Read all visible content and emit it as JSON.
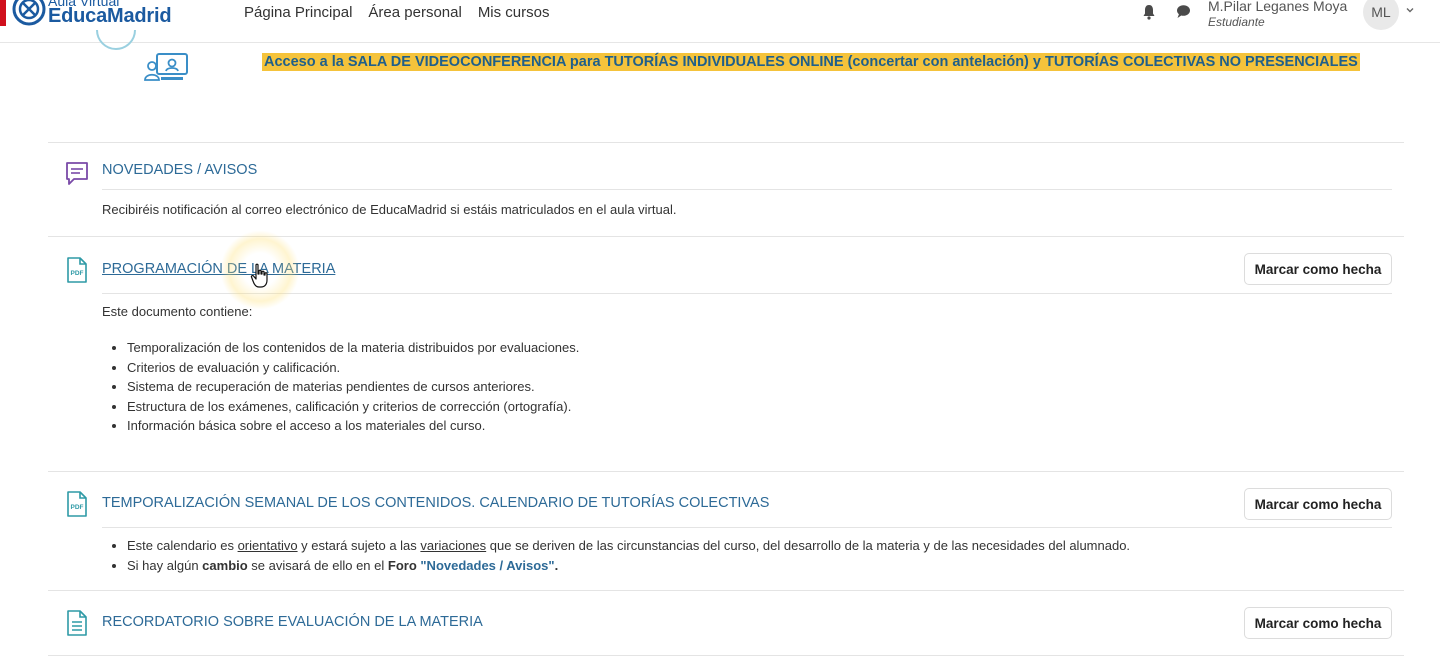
{
  "navbar": {
    "brand_small": "Aula Virtual",
    "brand_big": "EducaMadrid",
    "links": [
      "Página Principal",
      "Área personal",
      "Mis cursos"
    ],
    "user_name": "M.Pilar Leganes Moya",
    "user_role": "Estudiante",
    "avatar_initials": "ML"
  },
  "banner": {
    "text": "Acceso a la SALA DE VIDEOCONFERENCIA para TUTORÍAS INDIVIDUALES ONLINE (concertar con antelación) y TUTORÍAS COLECTIVAS NO PRESENCIALES",
    "highlight_color": "#f5c33b"
  },
  "activities": [
    {
      "title": "NOVEDADES / AVISOS",
      "icon": "forum-icon",
      "description": "Recibiréis notificación al correo electrónico de EducaMadrid si estáis matriculados en el aula virtual."
    },
    {
      "title": "PROGRAMACIÓN DE LA MATERIA",
      "icon": "pdf-icon",
      "button": "Marcar como hecha",
      "intro": "Este documento contiene:",
      "bullets": [
        "Temporalización de los contenidos de la materia distribuidos por evaluaciones.",
        "Criterios de evaluación y calificación.",
        "Sistema de recuperación de materias pendientes de cursos anteriores.",
        "Estructura de los exámenes, calificación y criterios de corrección (ortografía).",
        "Información básica sobre el acceso a los materiales del curso."
      ]
    },
    {
      "title": "TEMPORALIZACIÓN SEMANAL DE LOS CONTENIDOS. CALENDARIO DE TUTORÍAS COLECTIVAS",
      "icon": "pdf-icon",
      "button": "Marcar como hecha",
      "bullet1": {
        "p1": "Este calendario es ",
        "u1": "orientativo",
        "p2": " y estará sujeto a las ",
        "u2": "variaciones",
        "p3": " que se deriven de las circunstancias del curso, del desarrollo de la materia y de las necesidades del alumnado."
      },
      "bullet2": {
        "p1": "Si hay algún ",
        "b1": "cambio",
        "p2": " se avisará de ello en el ",
        "b2": "Foro ",
        "link": "\"Novedades / Avisos\"",
        "p3": "."
      }
    },
    {
      "title": "RECORDATORIO SOBRE EVALUACIÓN DE LA MATERIA",
      "icon": "page-icon",
      "button": "Marcar como hecha"
    }
  ],
  "colors": {
    "brand_blue": "#1b5aa0",
    "title_blue": "#2d6a97",
    "brand_red": "#d0101d",
    "icon_teal": "#2e9aa6",
    "icon_purple": "#7a4aa8"
  }
}
